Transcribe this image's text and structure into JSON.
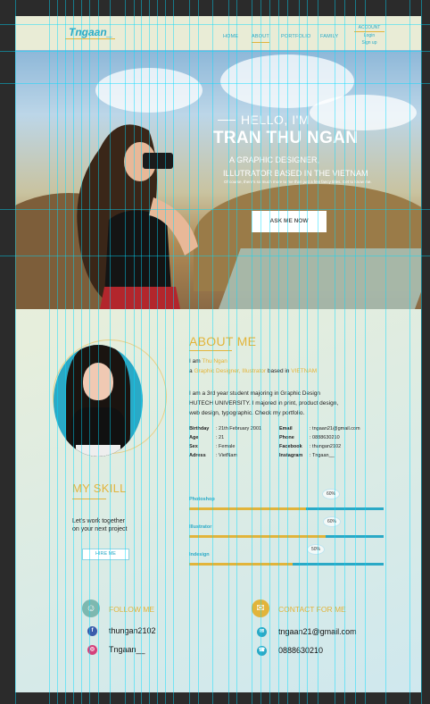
{
  "nav": {
    "logo": "Tngaan_",
    "items": [
      "HOME",
      "ABOUT",
      "PORTFOLIO",
      "FAMILY"
    ],
    "account": {
      "title": "ACCOUNT",
      "login": "Login",
      "signup": "Sign up"
    }
  },
  "hero": {
    "hello": "HELLO, I'M",
    "name": "TRAN THU NGAN",
    "sub1": "A GRAPHIC DESIGNER,",
    "sub2": "ILLUTRATOR BASED IN THE VIETNAM",
    "desc": "Of course, there's so much more to me than just a few fancy titles. Get to know me.",
    "button": "ASK ME NOW"
  },
  "about": {
    "title": "ABOUT ME",
    "iam": "I am",
    "name": "Thu Ngan",
    "a": "a",
    "role1": "Graphic Designer",
    "comma": ",",
    "role2": "Illustrator",
    "basedin": "based in",
    "country": "VIETNAM",
    "bio1": "I am a 3rd year student majoring in Graphic Design",
    "bio2": "HUTECH UNIVERSITY. I majored in print, product design,",
    "bio3": "web design, typographic. Check my portfolio.",
    "info_left": [
      {
        "k": "Birthday",
        "v": ": 21th February 2001"
      },
      {
        "k": "Age",
        "v": ": 21"
      },
      {
        "k": "Sex",
        "v": ": Female"
      },
      {
        "k": "Adress",
        "v": ": VietNam"
      }
    ],
    "info_right": [
      {
        "k": "Email",
        "v": ": tngaan21@gmail.com"
      },
      {
        "k": "Phone",
        "v": ": 0888630210"
      },
      {
        "k": "Facebook",
        "v": ": thungan2102"
      },
      {
        "k": "Instagram",
        "v": ": Tngaan__"
      }
    ]
  },
  "skill": {
    "title": "MY SKILL",
    "text1": "Let's work together",
    "text2": "on your next project",
    "hire": "HIRE ME",
    "bars": [
      {
        "name": "Photoshop",
        "percent": 60,
        "label": "60%"
      },
      {
        "name": "Illustrator",
        "percent": 70,
        "label": "60%"
      },
      {
        "name": "Indesign",
        "percent": 53,
        "label": "50%"
      }
    ]
  },
  "follow": {
    "title": "FOLLOW ME",
    "facebook": "thungan2102",
    "instagram": "Tngaan__"
  },
  "contact": {
    "title": "CONTACT FOR ME",
    "email": "tngaan21@gmail.com",
    "phone": "0888630210"
  },
  "colors": {
    "accent": "#e2b43a",
    "teal": "#2aa9c6"
  },
  "icons": {
    "follow": "follow-icon",
    "contact": "mail-icon",
    "facebook": "facebook-icon",
    "instagram": "instagram-icon",
    "email": "email-icon",
    "phone": "phone-icon"
  }
}
